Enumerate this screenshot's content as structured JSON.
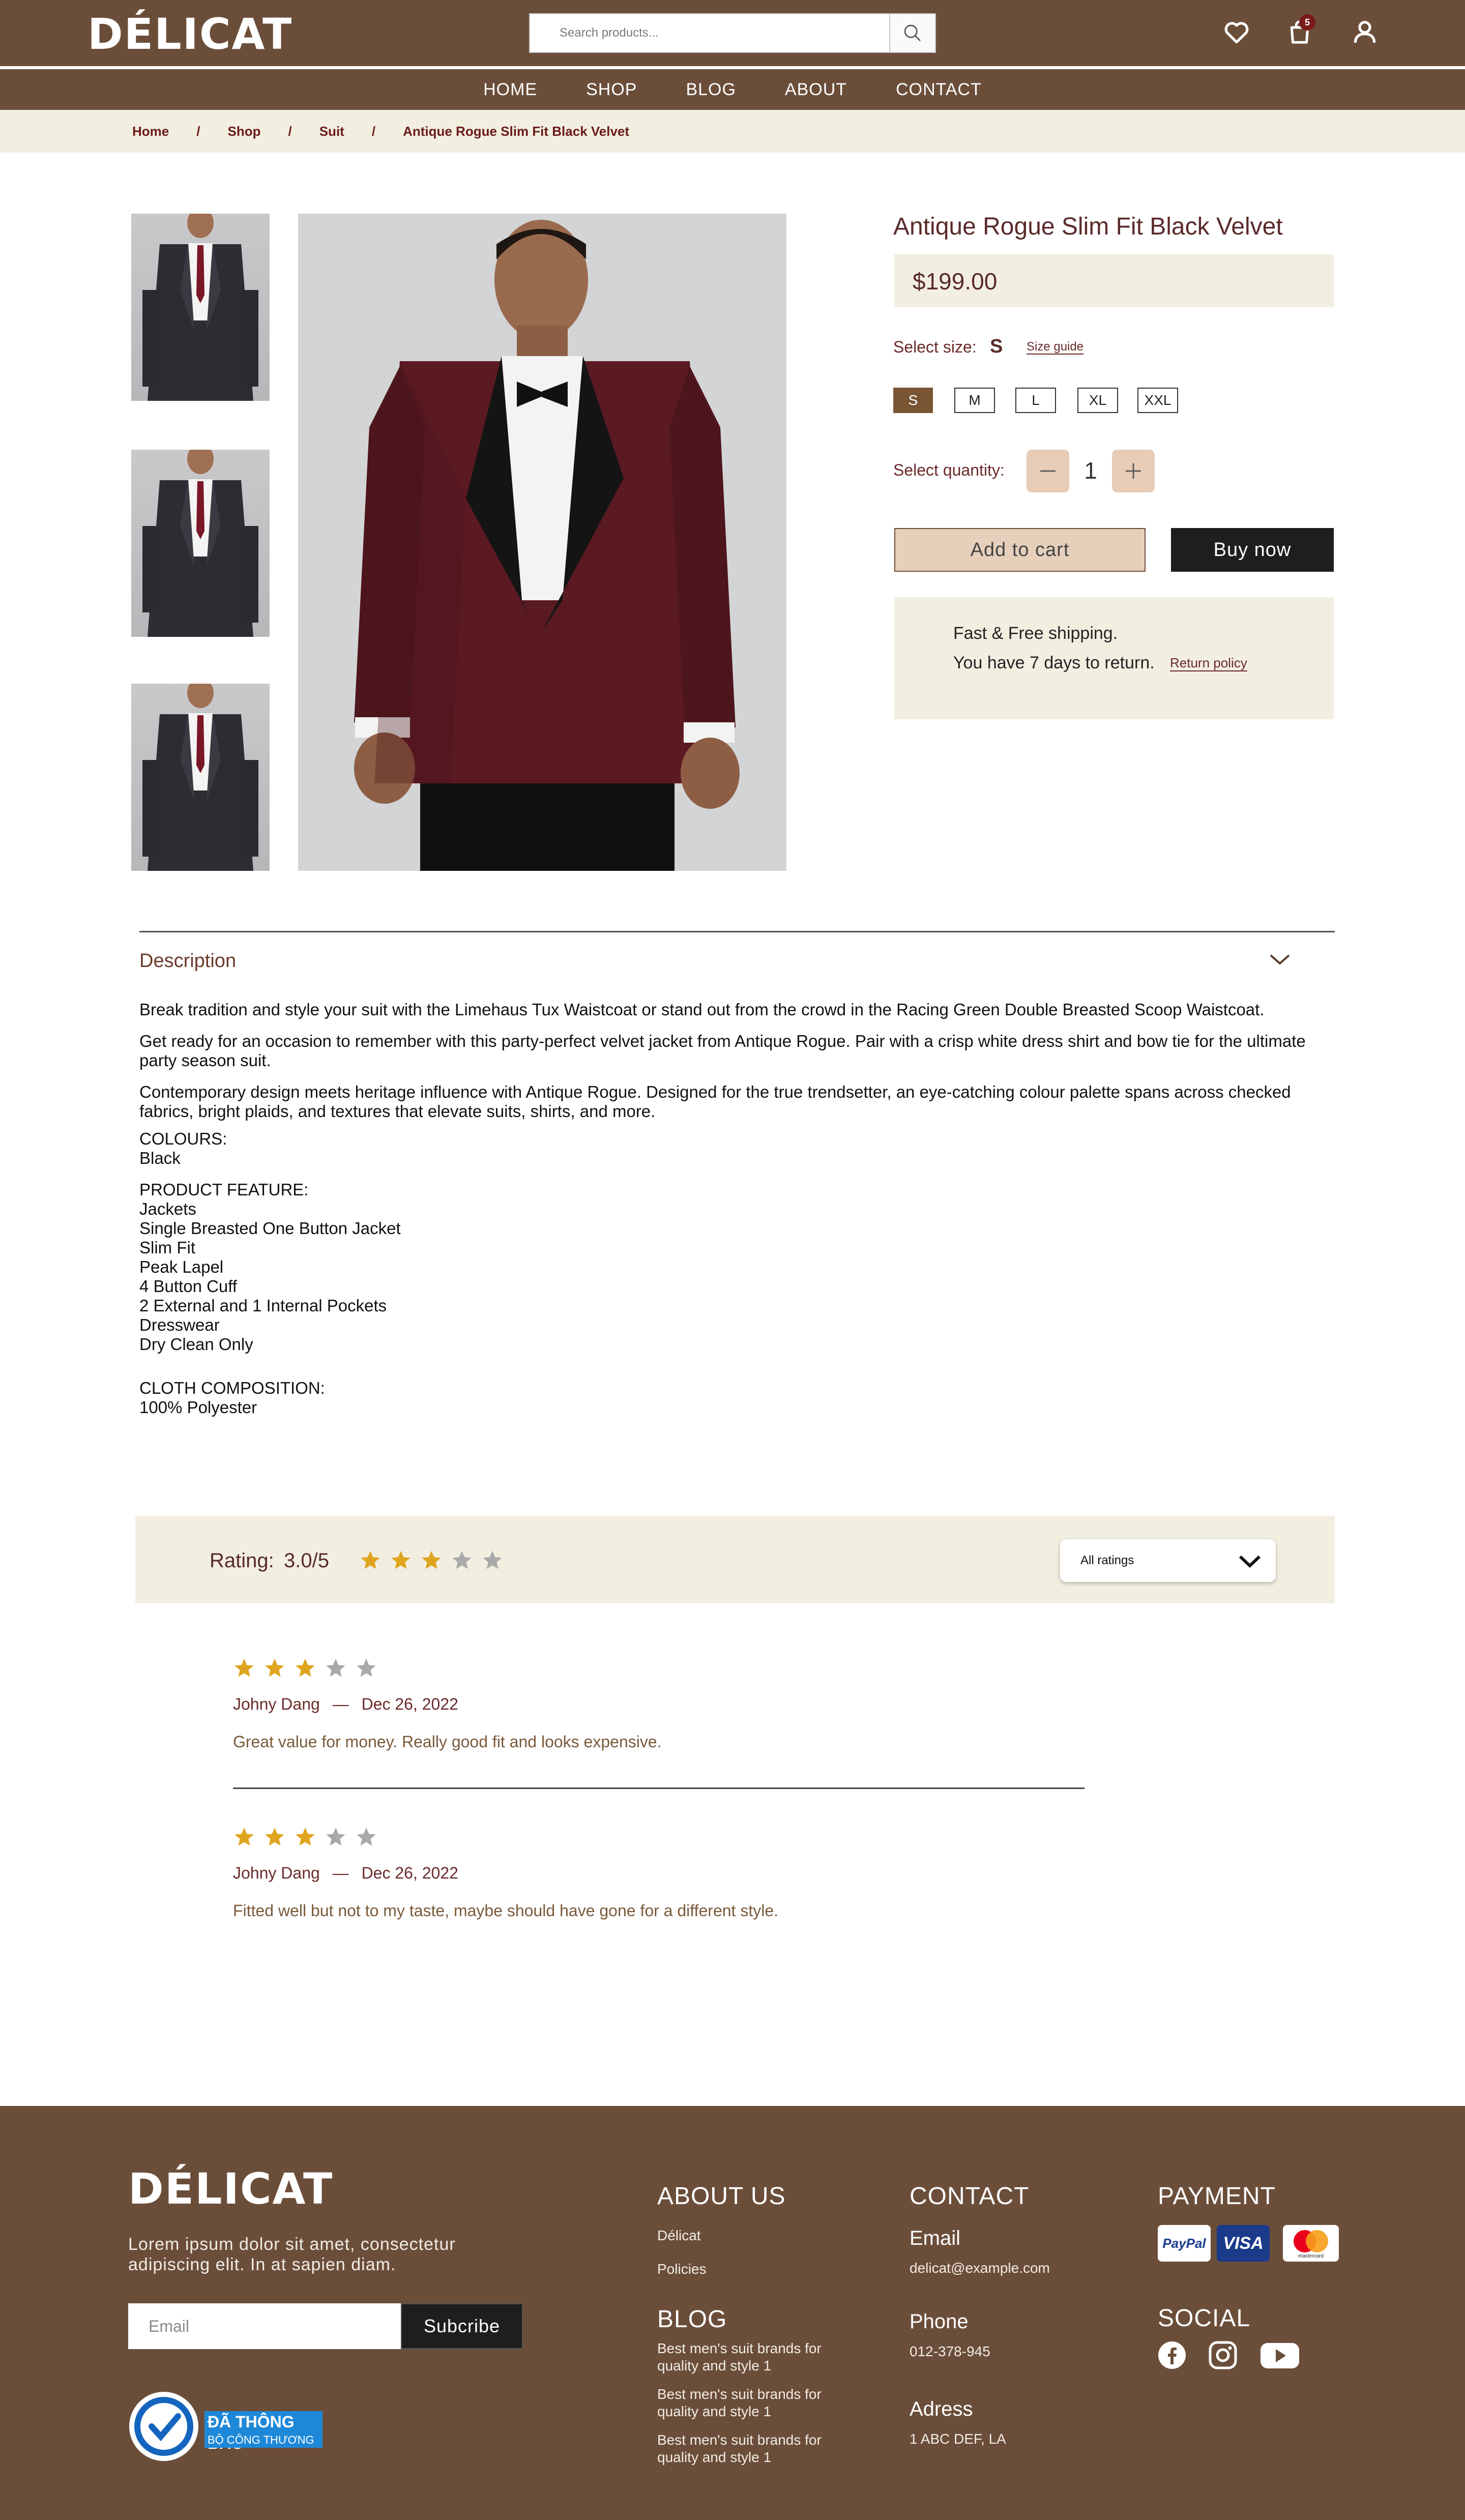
{
  "header": {
    "logo": "DÉLICAT",
    "search_placeholder": "Search products...",
    "cart_count": "5",
    "nav": [
      "HOME",
      "SHOP",
      "BLOG",
      "ABOUT",
      "CONTACT"
    ]
  },
  "breadcrumb": [
    "Home",
    "Shop",
    "Suit",
    "Antique Rogue Slim Fit Black Velvet"
  ],
  "product": {
    "title": "Antique Rogue Slim Fit Black Velvet",
    "price": "$199.00",
    "select_size_label": "Select size:",
    "selected_size": "S",
    "size_guide": "Size guide",
    "sizes": [
      "S",
      "M",
      "L",
      "XL",
      "XXL"
    ],
    "select_quantity_label": "Select quantity:",
    "quantity": "1",
    "add_to_cart": "Add to cart",
    "buy_now": "Buy now",
    "shipping": "Fast & Free shipping.",
    "return_text": "You have 7 days to return.",
    "return_policy": "Return policy"
  },
  "description": {
    "title": "Description",
    "paragraphs": [
      "Break tradition and style your suit with the Limehaus Tux Waistcoat or stand out from the crowd in the Racing Green Double Breasted Scoop Waistcoat.",
      "Get ready for an occasion to remember with this party-perfect velvet jacket from Antique Rogue. Pair with a crisp white dress shirt and bow tie for the ultimate party season suit.",
      "Contemporary design meets heritage influence with Antique Rogue. Designed for the true trendsetter, an eye-catching colour palette spans across checked fabrics, bright plaids, and textures that elevate suits, shirts, and more."
    ],
    "colours_label": "COLOURS:",
    "colours": [
      "Black"
    ],
    "features_label": "PRODUCT FEATURE:",
    "features": [
      "Jackets",
      "Single Breasted One Button Jacket",
      "Slim Fit",
      "Peak Lapel",
      "4 Button Cuff",
      "2 External and 1 Internal Pockets",
      "Dresswear",
      "Dry Clean Only"
    ],
    "composition_label": "CLOTH COMPOSITION:",
    "composition": [
      "100% Polyester"
    ]
  },
  "ratings": {
    "label": "Rating:",
    "value": "3.0/5",
    "stars": 3,
    "filter": "All ratings",
    "reviews": [
      {
        "stars": 3,
        "author": "Johny Dang",
        "dash": "—",
        "date": "Dec 26, 2022",
        "text": "Great value for money. Really good fit and looks expensive."
      },
      {
        "stars": 3,
        "author": "Johny Dang",
        "dash": "—",
        "date": "Dec 26, 2022",
        "text": "Fitted well but not to my taste, maybe should have gone for a different style."
      }
    ]
  },
  "footer": {
    "logo": "DÉLICAT",
    "tagline": "Lorem ipsum dolor sit amet, consectetur adipiscing elit. In at sapien diam.",
    "email_placeholder": "Email",
    "subscribe": "Subcribe",
    "badge_title": "ĐÃ THÔNG BÁO",
    "badge_sub": "BỘ CÔNG THƯƠNG",
    "about_heading": "ABOUT US",
    "about_links": [
      "Délicat",
      "Policies"
    ],
    "blog_heading": "BLOG",
    "blog_links": [
      "Best men's suit brands for quality and style 1",
      "Best men's suit brands for quality and style 1",
      "Best men's suit brands for quality and style 1"
    ],
    "contact_heading": "CONTACT",
    "email_label": "Email",
    "email_value": "delicat@example.com",
    "phone_label": "Phone",
    "phone_value": "012-378-945",
    "address_label": "Adress",
    "address_value": "1 ABC DEF, LA",
    "payment_heading": "PAYMENT",
    "payment_methods": [
      "PayPal",
      "VISA",
      "mastercard"
    ],
    "social_heading": "SOCIAL",
    "social": [
      "facebook-icon",
      "instagram-icon",
      "youtube-icon"
    ]
  },
  "colors": {
    "brand_brown": "#6b4e3a",
    "cream": "#f2efe1",
    "star_gold": "#e0a51e",
    "star_grey": "#a9a9a9"
  }
}
